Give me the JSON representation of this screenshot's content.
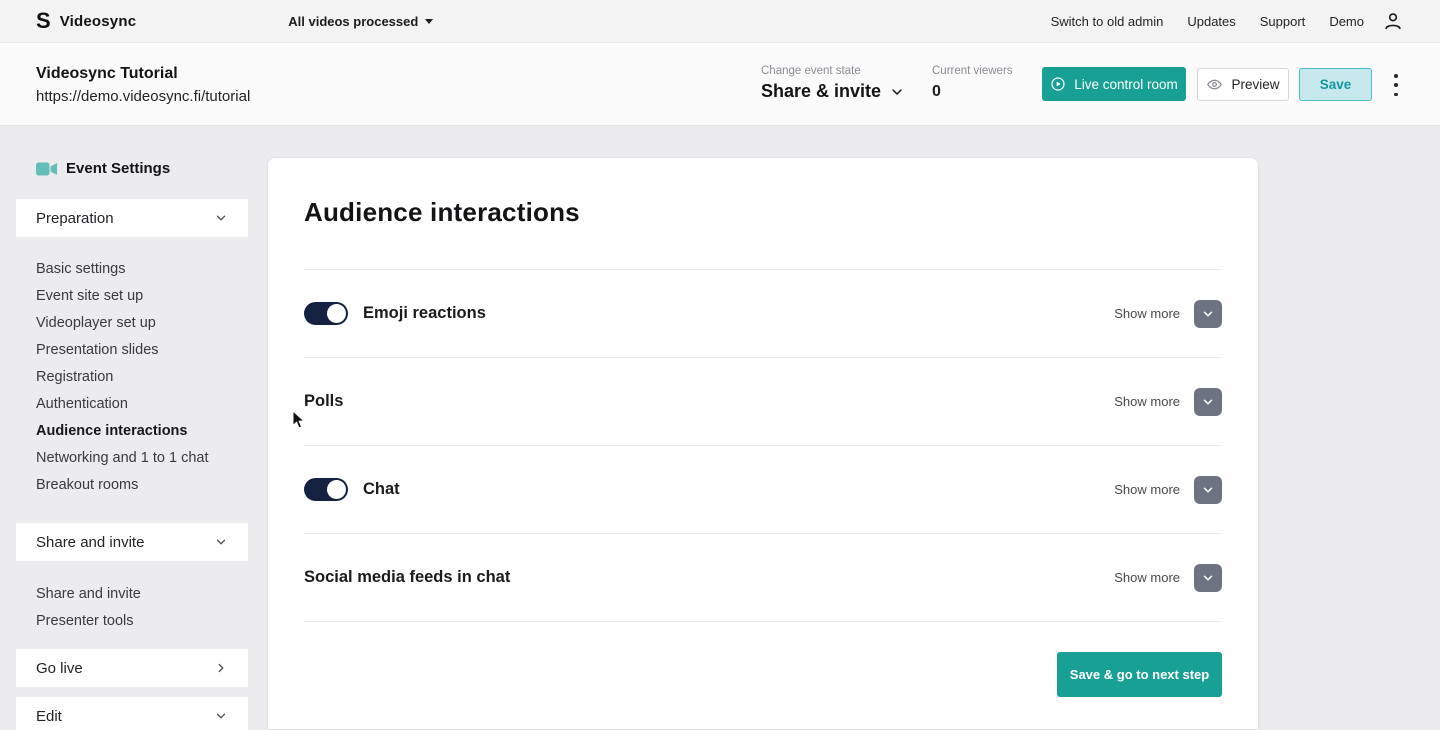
{
  "topbar": {
    "brand": "Videosync",
    "videos_status": "All videos processed",
    "links": {
      "switch_admin": "Switch to old admin",
      "updates": "Updates",
      "support": "Support",
      "demo": "Demo"
    }
  },
  "header": {
    "title": "Videosync Tutorial",
    "url": "https://demo.videosync.fi/tutorial",
    "event_state_label": "Change event state",
    "event_state_value": "Share & invite",
    "viewers_label": "Current viewers",
    "viewers_count": "0",
    "live_button": "Live control room",
    "preview_button": "Preview",
    "save_button": "Save"
  },
  "sidebar": {
    "heading": "Event Settings",
    "preparation": {
      "label": "Preparation",
      "items": [
        "Basic settings",
        "Event site set up",
        "Videoplayer set up",
        "Presentation slides",
        "Registration",
        "Authentication",
        "Audience interactions",
        "Networking and 1 to 1 chat",
        "Breakout rooms"
      ],
      "active_item": "Audience interactions"
    },
    "share_section": {
      "label": "Share and invite",
      "items": [
        "Share and invite",
        "Presenter tools"
      ]
    },
    "go_live": {
      "label": "Go live"
    },
    "edit": {
      "label": "Edit"
    }
  },
  "main": {
    "title": "Audience interactions",
    "rows": [
      {
        "label": "Emoji reactions",
        "has_toggle": true,
        "toggle_on": true,
        "show_more": "Show more"
      },
      {
        "label": "Polls",
        "has_toggle": false,
        "show_more": "Show more"
      },
      {
        "label": "Chat",
        "has_toggle": true,
        "toggle_on": true,
        "show_more": "Show more"
      },
      {
        "label": "Social media feeds in chat",
        "has_toggle": false,
        "show_more": "Show more"
      }
    ],
    "save_next_label": "Save & go to next step"
  },
  "colors": {
    "accent_teal": "#18A095",
    "toggle_navy": "#152140",
    "save_light_bg": "#C7E9EE",
    "save_border": "#4CBFC6",
    "save_text": "#15969E",
    "show_more_button": "#6D7380",
    "camera_icon_teal": "#63BDB9"
  }
}
